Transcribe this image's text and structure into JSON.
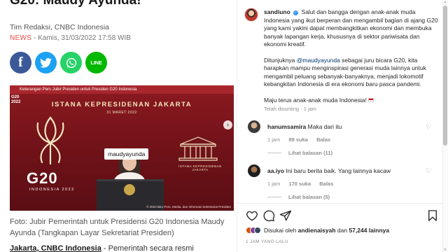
{
  "article": {
    "headline": "G20: Maudy Ayunda!",
    "byline": "Tim Redaksi, CNBC Indonesia",
    "source": "NEWS",
    "date": " - Kamis, 31/03/2022 17:58 WIB",
    "share_icons": [
      "facebook-icon",
      "twitter-icon",
      "whatsapp-icon",
      "line-icon"
    ],
    "line_label": "LINE",
    "photo": {
      "ticker": "Keterangan Pers Jubir Presiden untuk Presiden G20 Indonesia",
      "logo": "G20",
      "logo_sub": "2022",
      "title": "ISTANA KEPRESIDENAN JAKARTA",
      "date": "31 MARET 2022",
      "g20_text": "G20",
      "g20_sub": "INDONESIA 2022",
      "palace_label": "ISTANA KEPRESIDENAN JAKARTA",
      "name_tag": "maudyayunda",
      "copyright": "© 2022 Biro Pers, Media, dan Informasi Sekretariat Presiden"
    },
    "caption": "Foto: Jubir Pemerintah untuk Presidensi G20 Indonesia Maudy Ayunda (Tangkapan Layar Sekretariat Presiden)",
    "lead_bold": "Jakarta, CNBC Indonesia",
    "lead_rest": " - Pemerintah secara resmi"
  },
  "instagram": {
    "post_user": "sandiuno",
    "caption_p1": "Salut dan bangga dengan anak-anak muda Indonesia yang ikut berperan dan mengambil bagian di ajang G20 yang kami yakini dapat membangkitkan ekonomi dan membuka banyak lapangan kerja, khususnya di sektor pariwisata dan ekonomi kreatif.",
    "caption_p2_before": "Ditunjuknya ",
    "caption_p2_mention": "@maudyayunda",
    "caption_p2_after": " sebagai juru bicara G20, kita harapkan mampu menginspirasi generasi muda lainnya untuk mengambil peluang sebanyak-banyaknya, menjadi lokomotif kebangkitan Indonesia di era ekonomi baru pasca pandemi.",
    "caption_p3": "Maju terus anak-anak muda Indonesia! ",
    "edited": "Telah disunting · 1 jam",
    "comments": [
      {
        "user": "hanumsamira",
        "text": "Maka dari itu",
        "time": "1 jam",
        "likes": "89 suka",
        "reply": "Balas",
        "replies": "Lihat balasan (11)"
      },
      {
        "user": "aa.iyo",
        "text": "Ini baru berita baik. Yang lainnya kacaw",
        "time": "1 jam",
        "likes": "170 suka",
        "reply": "Balas",
        "replies": "Lihat balasan (5)"
      }
    ],
    "liked_by_prefix": "Disukai oleh ",
    "liked_by_user": "andienaisyah",
    "liked_by_mid": " dan ",
    "liked_by_count": "57,244 lainnya",
    "time_ago": "1 JAM YANG LALU"
  }
}
